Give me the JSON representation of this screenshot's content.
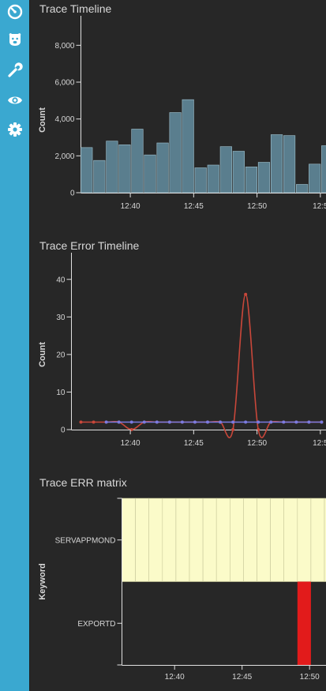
{
  "sidebar": {
    "items": [
      {
        "icon": "dashboard-gauge-icon"
      },
      {
        "icon": "bear-face-icon"
      },
      {
        "icon": "wrench-icon"
      },
      {
        "icon": "eye-icon"
      },
      {
        "icon": "gear-icon"
      }
    ]
  },
  "colors": {
    "sidebar_bg": "#3aa8d0",
    "panel_bg": "#272727",
    "bar_fill": "#5a7e8e",
    "error_line": "#c8473a",
    "flat_line": "#7b7be0",
    "matrix_cell": "#fbfbc9",
    "matrix_alert": "#e21b1b"
  },
  "panels": {
    "trace_timeline": {
      "title": "Trace Timeline",
      "chart_data": {
        "type": "bar",
        "ylabel": "Count",
        "ylim": [
          0,
          9000
        ],
        "yticks": [
          "0",
          "2,000",
          "4,000",
          "6,000",
          "8,000"
        ],
        "xticks": [
          "12:40",
          "12:45",
          "12:50",
          "12:5"
        ],
        "bin_minutes": 1,
        "x_start_minute": 36.1,
        "values": [
          2450,
          1750,
          2800,
          2600,
          3450,
          2050,
          2700,
          4350,
          5050,
          1350,
          1500,
          2500,
          2250,
          1400,
          1650,
          3150,
          3100,
          450,
          1550,
          2550
        ],
        "grid": false
      }
    },
    "trace_error_timeline": {
      "title": "Trace Error Timeline",
      "chart_data": {
        "type": "line",
        "ylabel": "Count",
        "ylim": [
          0,
          45
        ],
        "yticks": [
          "0",
          "10",
          "20",
          "30",
          "40"
        ],
        "xticks": [
          "12:40",
          "12:45",
          "12:50",
          "12:5"
        ],
        "series": [
          {
            "color": "#c8473a",
            "x": [
              36.1,
              37.1,
              38.1,
              39.1,
              40.1,
              41.1,
              42.1,
              43.1,
              44.1,
              45.1,
              46.1,
              47.1,
              48.1,
              49.1,
              50.1,
              51.1,
              52.1,
              53.1,
              54.1,
              55.1
            ],
            "values": [
              2,
              2,
              2,
              2,
              0,
              2,
              2,
              2,
              2,
              2,
              2,
              2,
              0,
              36,
              0,
              2,
              2,
              2,
              2,
              2
            ]
          },
          {
            "color": "#7b7be0",
            "x": [
              38.1,
              39.1,
              40.1,
              41.1,
              42.1,
              43.1,
              44.1,
              45.1,
              46.1,
              47.1,
              48.1,
              49.1,
              50.1,
              51.1,
              52.1,
              53.1,
              54.1,
              55.1
            ],
            "values": [
              2,
              2,
              2,
              2,
              2,
              2,
              2,
              2,
              2,
              2,
              2,
              2,
              2,
              2,
              2,
              2,
              2,
              2
            ]
          }
        ],
        "grid": false
      }
    },
    "trace_err_matrix": {
      "title": "Trace ERR matrix",
      "chart_data": {
        "type": "heatmap",
        "ylabel": "Keyword",
        "rows": [
          "SERVAPPMOND",
          "EXPORTD"
        ],
        "xticks": [
          "12:40",
          "12:45",
          "12:50"
        ],
        "x_start_minute": 36.1,
        "cells": [
          [
            1,
            1,
            1,
            1,
            1,
            1,
            1,
            1,
            1,
            1,
            1,
            1,
            1,
            1,
            1,
            1,
            1,
            1,
            1,
            1
          ],
          [
            0,
            0,
            0,
            0,
            0,
            0,
            0,
            0,
            0,
            0,
            0,
            0,
            0,
            2,
            0,
            0,
            0,
            0,
            0,
            0
          ]
        ]
      }
    }
  }
}
